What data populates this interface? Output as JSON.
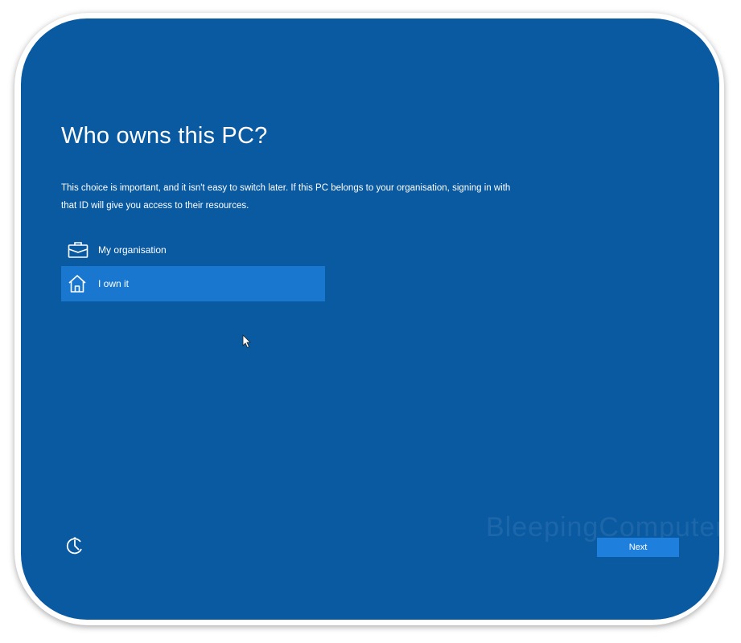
{
  "page": {
    "title": "Who owns this PC?",
    "description": "This choice is important, and it isn't easy to switch later. If this PC belongs to your organisation, signing in with that ID will give you access to their resources."
  },
  "options": [
    {
      "label": "My organisation",
      "icon": "briefcase-icon",
      "selected": false
    },
    {
      "label": "I own it",
      "icon": "home-icon",
      "selected": true
    }
  ],
  "footer": {
    "accessibility_icon": "ease-of-access-icon",
    "next_label": "Next"
  },
  "watermark": {
    "text": "BleepingComputer"
  },
  "colors": {
    "background": "#0a5aa2",
    "selected_option": "#1a77cf",
    "next_button": "#1e80dc",
    "text": "#ffffff"
  }
}
